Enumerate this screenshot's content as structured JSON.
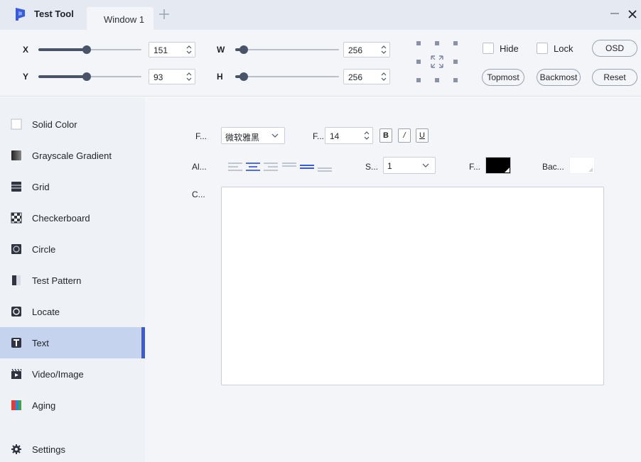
{
  "app": {
    "title": "Test Tool",
    "brand_color": "#3a5bd9"
  },
  "tabs": [
    {
      "label": "Window 1"
    }
  ],
  "controls": {
    "x": {
      "label": "X",
      "value": "151",
      "slider_fraction": 0.47
    },
    "y": {
      "label": "Y",
      "value": "93",
      "slider_fraction": 0.47
    },
    "w": {
      "label": "W",
      "value": "256",
      "slider_fraction": 0.08
    },
    "h": {
      "label": "H",
      "value": "256",
      "slider_fraction": 0.08
    },
    "hide": {
      "label": "Hide",
      "checked": false
    },
    "lock": {
      "label": "Lock",
      "checked": false
    },
    "osd_label": "OSD",
    "topmost_label": "Topmost",
    "backmost_label": "Backmost",
    "reset_label": "Reset"
  },
  "sidebar": {
    "items": [
      {
        "label": "Solid Color",
        "icon": "solid-color-icon"
      },
      {
        "label": "Grayscale Gradient",
        "icon": "gradient-icon"
      },
      {
        "label": "Grid",
        "icon": "grid-icon"
      },
      {
        "label": "Checkerboard",
        "icon": "checkerboard-icon"
      },
      {
        "label": "Circle",
        "icon": "circle-icon"
      },
      {
        "label": "Test Pattern",
        "icon": "test-pattern-icon"
      },
      {
        "label": "Locate",
        "icon": "locate-icon"
      },
      {
        "label": "Text",
        "icon": "text-icon",
        "active": true
      },
      {
        "label": "Video/Image",
        "icon": "video-icon"
      },
      {
        "label": "Aging",
        "icon": "aging-icon"
      }
    ],
    "settings_label": "Settings"
  },
  "text_panel": {
    "font_label": "F...",
    "font_value": "微软雅黑",
    "size_label": "F...",
    "size_value": "14",
    "bold": "B",
    "italic": "/",
    "underline": "U",
    "align_label": "Al...",
    "spacing_label": "S...",
    "spacing_value": "1",
    "fore_label": "F...",
    "fore_color": "#000000",
    "back_label": "Bac...",
    "back_color": "#ffffff",
    "content_label": "C...",
    "content_value": ""
  }
}
